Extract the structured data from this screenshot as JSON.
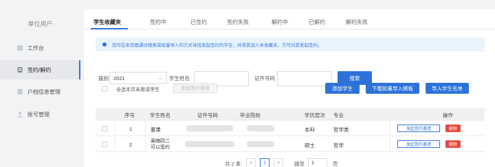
{
  "sidebar": {
    "title": "单位用户",
    "items": [
      {
        "label": "工作台"
      },
      {
        "label": "签约/解约"
      },
      {
        "label": "户档信息管理"
      },
      {
        "label": "账号管理"
      }
    ]
  },
  "tabs": [
    "学生收藏夹",
    "签约中",
    "已签约",
    "签约失败",
    "解约中",
    "已解约",
    "解约失败"
  ],
  "notice": "您可在本页面通过搜索或批量导入的方式寻找发起签约的学生，并将其加入本收藏夹，方可对其发起签约。",
  "filters": {
    "session_label": "届别",
    "session_value": "2021",
    "name_label": "学生姓名",
    "id_label": "证件号码",
    "search_button": "搜索"
  },
  "bulk": {
    "select_all_label": "全选本页未邀请学生",
    "send_invite_button": "发起签约邀请",
    "add_student_button": "添加学生",
    "download_template_button": "下载批量导入模板",
    "import_list_button": "导入学生名单"
  },
  "table": {
    "headers": [
      "序号",
      "学生姓名",
      "证件号码",
      "毕业院校",
      "学历层次",
      "专业",
      "操作"
    ],
    "rows": [
      {
        "index": "1",
        "name": "惠果",
        "degree": "本科",
        "major": "哲学类",
        "invite": "发起签约邀请",
        "delete": "删除"
      },
      {
        "index": "2",
        "name": "蔺缩四二 可以签约",
        "degree": "硕士",
        "major": "哲学",
        "invite": "发起签约邀请",
        "delete": "删除"
      }
    ]
  },
  "pagination": {
    "total": "共 2 条",
    "prev": "<",
    "current": "1",
    "next": ">",
    "goto_label": "跳至",
    "goto_value": "1",
    "page_unit": "页"
  },
  "colors": {
    "primary": "#2d72d9",
    "danger": "#e34a3c",
    "notice_bg": "#e8f3fd"
  }
}
